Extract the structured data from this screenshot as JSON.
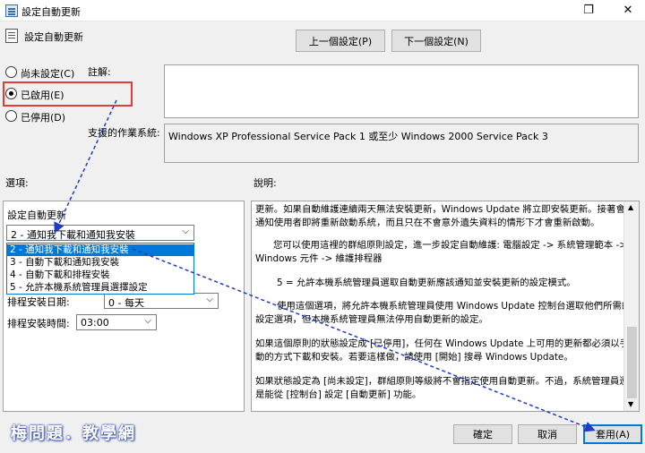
{
  "window": {
    "title": "設定自動更新",
    "restore_glyph": "❐",
    "close_glyph": "✕"
  },
  "header": {
    "title": "設定自動更新",
    "prev_button": "上一個設定(P)",
    "next_button": "下一個設定(N)"
  },
  "state_options": [
    {
      "label": "尚未設定(C)",
      "checked": false
    },
    {
      "label": "已啟用(E)",
      "checked": true
    },
    {
      "label": "已停用(D)",
      "checked": false
    }
  ],
  "comment": {
    "label": "註解:",
    "value": ""
  },
  "supported": {
    "label": "支援的作業系統:",
    "value": "Windows XP Professional Service Pack 1 或至少 Windows 2000 Service Pack 3"
  },
  "options": {
    "section_label": "選項:",
    "configure_label": "設定自動更新",
    "selected_value": "2 - 通知我下載和通知我安裝",
    "dropdown_items": [
      "2 - 通知我下載和通知我安裝",
      "3 - 自動下載和通知我安裝",
      "4 - 自動下載和排程安裝",
      "5 - 允許本機系統管理員選擇設定"
    ],
    "schedule_day_label": "排程安裝日期:",
    "schedule_day_value": "0 - 每天",
    "schedule_time_label": "排程安裝時間:",
    "schedule_time_value": "03:00"
  },
  "help": {
    "section_label": "說明:",
    "paragraphs": [
      "更新。如果自動維護連續兩天無法安裝更新，Windows Update 將立即安裝更新。接著會通知使用者即將重新啟動系統，而且只在不會意外遺失資料的情形下才會重新啟動。",
      "您可以使用這裡的群組原則設定，進一步設定自動維護: 電腦設定 -> 系統管理範本 -> Windows 元件 -> 維護排程器",
      "5 = 允許本機系統管理員選取自動更新應該通知並安裝更新的設定模式。",
      "使用這個選項，將允許本機系統管理員使用 Windows Update 控制台選取他們所需的設定選項，但本機系統管理員無法停用自動更新的設定。",
      "如果這個原則的狀態設定成 [已停用]，任何在 Windows Update 上可用的更新都必須以手動的方式下載和安裝。若要這樣做，請使用 [開始] 搜尋 Windows Update。",
      "如果狀態設定為 [尚未設定]，群組原則等級將不會指定使用自動更新。不過，系統管理員還是能從 [控制台] 設定 [自動更新] 功能。"
    ]
  },
  "footer": {
    "ok_button": "確定",
    "cancel_button": "取消",
    "apply_button": "套用(A)"
  },
  "watermark": {
    "text": "梅問題．教學網"
  },
  "annotation": {
    "highlight_color": "#e23b3b",
    "arrow_color": "#1e3cc8"
  }
}
